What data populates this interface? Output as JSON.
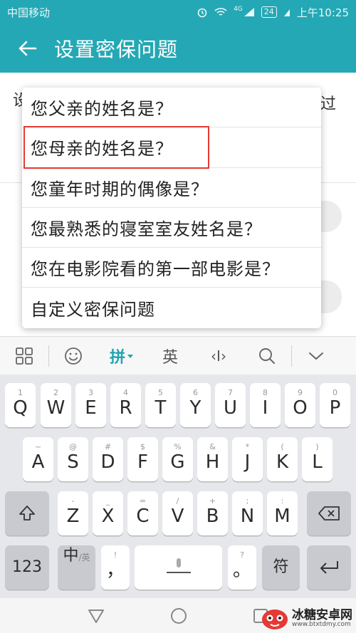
{
  "status_bar": {
    "carrier": "中国移动",
    "battery": "24",
    "time": "上午10:25",
    "signal_label": "4G"
  },
  "app_bar": {
    "title": "设置密保问题"
  },
  "background": {
    "left_char": "设",
    "right_char": "过"
  },
  "popup": {
    "options": [
      "您父亲的姓名是？",
      "您母亲的姓名是？",
      "您童年时期的偶像是？",
      "您最熟悉的寝室室友姓名是？",
      "您在电影院看的第一部电影是？",
      "自定义密保问题"
    ],
    "highlighted_index": 1,
    "highlight_color": "#e53935"
  },
  "keyboard_toolbar": {
    "pinyin": "拼",
    "english": "英",
    "cursor": "‹I›"
  },
  "keyboard": {
    "row1": [
      {
        "sub": "1",
        "main": "Q"
      },
      {
        "sub": "2",
        "main": "W"
      },
      {
        "sub": "3",
        "main": "E"
      },
      {
        "sub": "4",
        "main": "R"
      },
      {
        "sub": "5",
        "main": "T"
      },
      {
        "sub": "6",
        "main": "Y"
      },
      {
        "sub": "7",
        "main": "U"
      },
      {
        "sub": "8",
        "main": "I"
      },
      {
        "sub": "9",
        "main": "O"
      },
      {
        "sub": "0",
        "main": "P"
      }
    ],
    "row2": [
      {
        "sub": "~",
        "main": "A"
      },
      {
        "sub": "@",
        "main": "S"
      },
      {
        "sub": "#",
        "main": "D"
      },
      {
        "sub": "$",
        "main": "F"
      },
      {
        "sub": "%",
        "main": "G"
      },
      {
        "sub": "&",
        "main": "H"
      },
      {
        "sub": "*",
        "main": "J"
      },
      {
        "sub": "(",
        "main": "K"
      },
      {
        "sub": ")",
        "main": "L"
      }
    ],
    "row3": [
      {
        "sub": "-",
        "main": "Z"
      },
      {
        "sub": "_",
        "main": "X"
      },
      {
        "sub": "=",
        "main": "C"
      },
      {
        "sub": "/",
        "main": "V"
      },
      {
        "sub": "+",
        "main": "B"
      },
      {
        "sub": ";",
        "main": "N"
      },
      {
        "sub": ":",
        "main": "M"
      }
    ],
    "row4": {
      "num": "123",
      "lang_cn": "中",
      "lang_en": "/英",
      "comma_sub": "!",
      "comma": "，",
      "period_sub": "?",
      "period": "。",
      "symbols": "符"
    }
  },
  "accent_color": "#25a8b5",
  "watermark": {
    "name": "冰糖安卓网",
    "url": "www.btxtdmy.com"
  }
}
